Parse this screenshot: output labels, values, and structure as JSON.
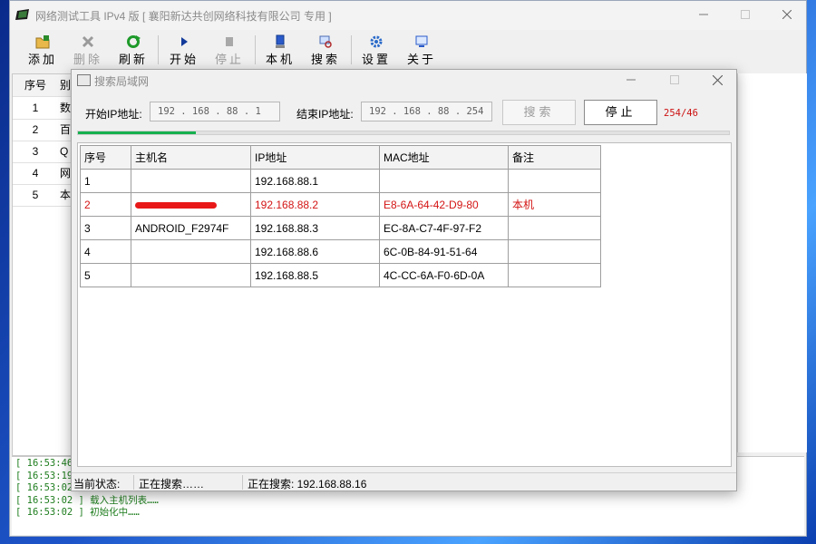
{
  "main": {
    "title": "网络测试工具 IPv4 版 [ 襄阳新达共创网络科技有限公司 专用 ]",
    "toolbar": [
      {
        "label": "添加",
        "icon": "add-icon",
        "enabled": true
      },
      {
        "label": "删除",
        "icon": "delete-icon",
        "enabled": false
      },
      {
        "label": "刷新",
        "icon": "refresh-icon",
        "enabled": true
      },
      {
        "label": "开始",
        "icon": "play-icon",
        "enabled": true
      },
      {
        "label": "停止",
        "icon": "stop-icon",
        "enabled": false
      },
      {
        "label": "本机",
        "icon": "computer-icon",
        "enabled": true
      },
      {
        "label": "搜索",
        "icon": "search-network-icon",
        "enabled": true
      },
      {
        "label": "设置",
        "icon": "settings-icon",
        "enabled": true
      },
      {
        "label": "关于",
        "icon": "about-icon",
        "enabled": true
      }
    ],
    "bg_table": {
      "headers": [
        "序号",
        "别"
      ],
      "rows": [
        [
          "1",
          "数"
        ],
        [
          "2",
          "百"
        ],
        [
          "3",
          "Q"
        ],
        [
          "4",
          "网"
        ],
        [
          "5",
          "本"
        ]
      ]
    },
    "log": [
      "[ 16:53:46",
      "[ 16:53:19",
      "[ 16:53:02",
      "[ 16:53:02 ] 载入主机列表……",
      "[ 16:53:02 ] 初始化中……"
    ]
  },
  "dialog": {
    "title": "搜索局域网",
    "start_label": "开始IP地址:",
    "start_ip": "192 . 168 . 88 . 1",
    "end_label": "结束IP地址:",
    "end_ip": "192 . 168 . 88 . 254",
    "search_button": "搜索",
    "stop_button": "停止",
    "progress_text": "254/46",
    "progress_fraction": 0.181,
    "table": {
      "headers": [
        "序号",
        "主机名",
        "IP地址",
        "MAC地址",
        "备注"
      ],
      "rows": [
        {
          "no": "1",
          "host": "",
          "redacted": false,
          "ip": "192.168.88.1",
          "mac": "",
          "note": "",
          "highlight": false
        },
        {
          "no": "2",
          "host": "",
          "redacted": true,
          "ip": "192.168.88.2",
          "mac": "E8-6A-64-42-D9-80",
          "note": "本机",
          "highlight": true
        },
        {
          "no": "3",
          "host": "ANDROID_F2974F",
          "redacted": false,
          "ip": "192.168.88.3",
          "mac": "EC-8A-C7-4F-97-F2",
          "note": "",
          "highlight": false
        },
        {
          "no": "4",
          "host": "",
          "redacted": true,
          "ip": "192.168.88.6",
          "mac": "6C-0B-84-91-51-64",
          "note": "",
          "highlight": false
        },
        {
          "no": "5",
          "host": "",
          "redacted": true,
          "ip": "192.168.88.5",
          "mac": "4C-CC-6A-F0-6D-0A",
          "note": "",
          "highlight": false
        }
      ]
    },
    "status": {
      "label": "当前状态:",
      "state": "正在搜索……",
      "detail": "正在搜索: 192.168.88.16"
    }
  }
}
